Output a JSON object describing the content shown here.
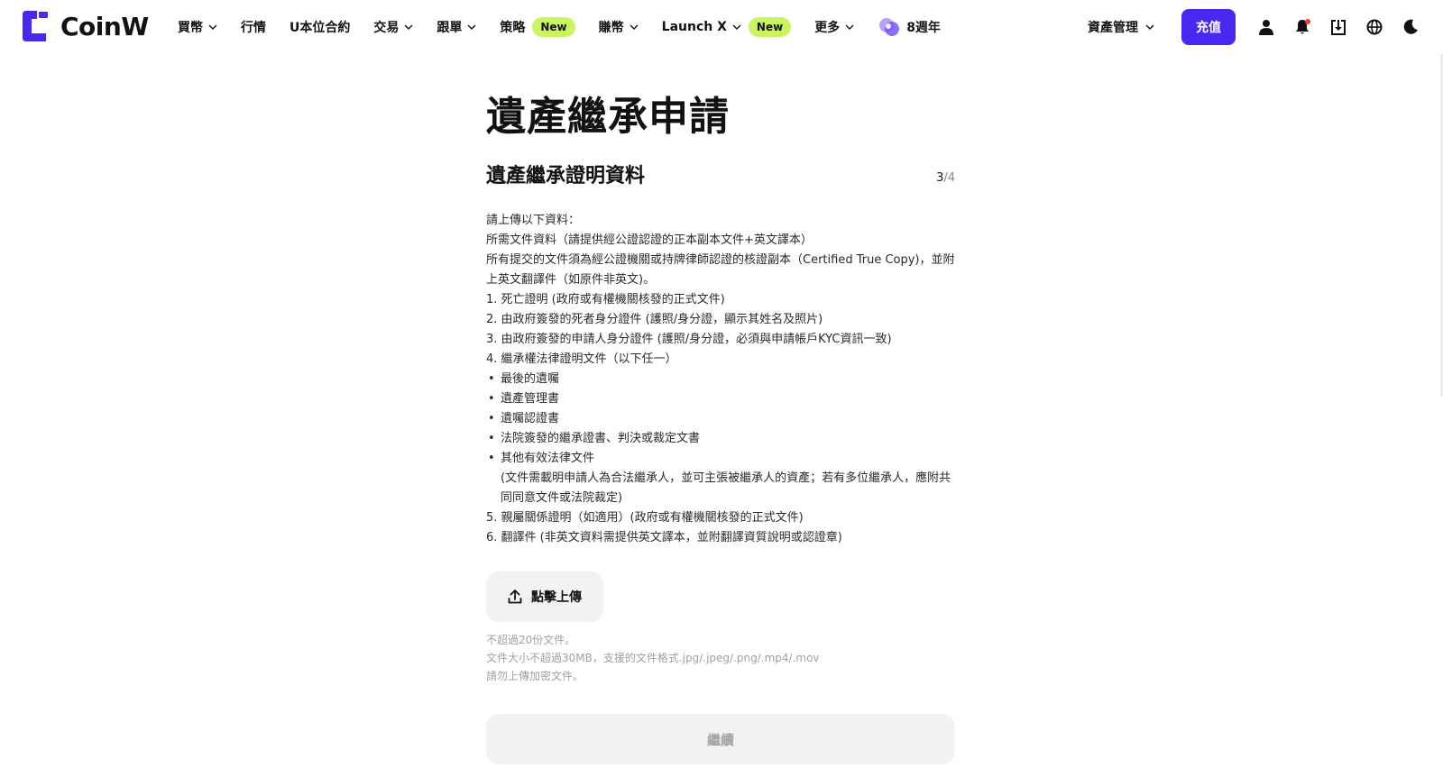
{
  "brand": {
    "name": "CoinW",
    "accent": "#4b28f2"
  },
  "nav": {
    "items": [
      {
        "label": "買幣",
        "dropdown": true
      },
      {
        "label": "行情",
        "dropdown": false
      },
      {
        "label": "U本位合約",
        "dropdown": false
      },
      {
        "label": "交易",
        "dropdown": true
      },
      {
        "label": "跟單",
        "dropdown": true
      },
      {
        "label": "策略",
        "dropdown": false,
        "badge": "New"
      },
      {
        "label": "賺幣",
        "dropdown": true
      },
      {
        "label": "Launch X",
        "dropdown": true,
        "badge": "New"
      },
      {
        "label": "更多",
        "dropdown": true
      }
    ],
    "anniversary": "8週年",
    "badge_color": "#c8f560"
  },
  "header_right": {
    "asset_management": "資產管理",
    "deposit": "充值",
    "icons": [
      "user-icon",
      "bell-icon",
      "download-icon",
      "globe-icon",
      "moon-icon"
    ]
  },
  "page": {
    "title": "遺產繼承申請",
    "section_title": "遺產繼承證明資料",
    "step_current": "3",
    "step_total": "/4",
    "instructions": {
      "intro": "請上傳以下資料：",
      "line1": "所需文件資料（請提供經公證認證的正本副本文件+英文譯本）",
      "line2": "所有提交的文件須為經公證機關或持牌律師認證的核證副本（Certified True Copy)，並附上英文翻譯件（如原件非英文)。",
      "item1": "1. 死亡證明 (政府或有權機關核發的正式文件)",
      "item2": "2. 由政府簽發的死者身分證件 (護照/身分證，顯示其姓名及照片)",
      "item3": "3. 由政府簽發的申請人身分證件 (護照/身分證，必須與申請帳戶KYC資訊一致)",
      "item4": "4. 繼承權法律證明文件（以下任一）",
      "bullets": [
        "最後的遺囑",
        "遺產管理書",
        "遺囑認證書",
        "法院簽發的繼承證書、判決或裁定文書",
        "其他有效法律文件"
      ],
      "bullet_note": "(文件需載明申請人為合法繼承人，並可主張被繼承人的資產；若有多位繼承人，應附共同同意文件或法院裁定)",
      "item5": "5. 親屬關係證明（如適用）(政府或有權機關核發的正式文件)",
      "item6": "6. 翻譯件 (非英文資料需提供英文譯本，並附翻譯資質說明或認證章)"
    },
    "upload_label": "點擊上傳",
    "hints": {
      "hint1": "不超過20份文件。",
      "hint2": "文件大小不超過30MB，支援的文件格式.jpg/.jpeg/.png/.mp4/.mov",
      "hint3": "請勿上傳加密文件。"
    },
    "continue_label": "繼續"
  }
}
